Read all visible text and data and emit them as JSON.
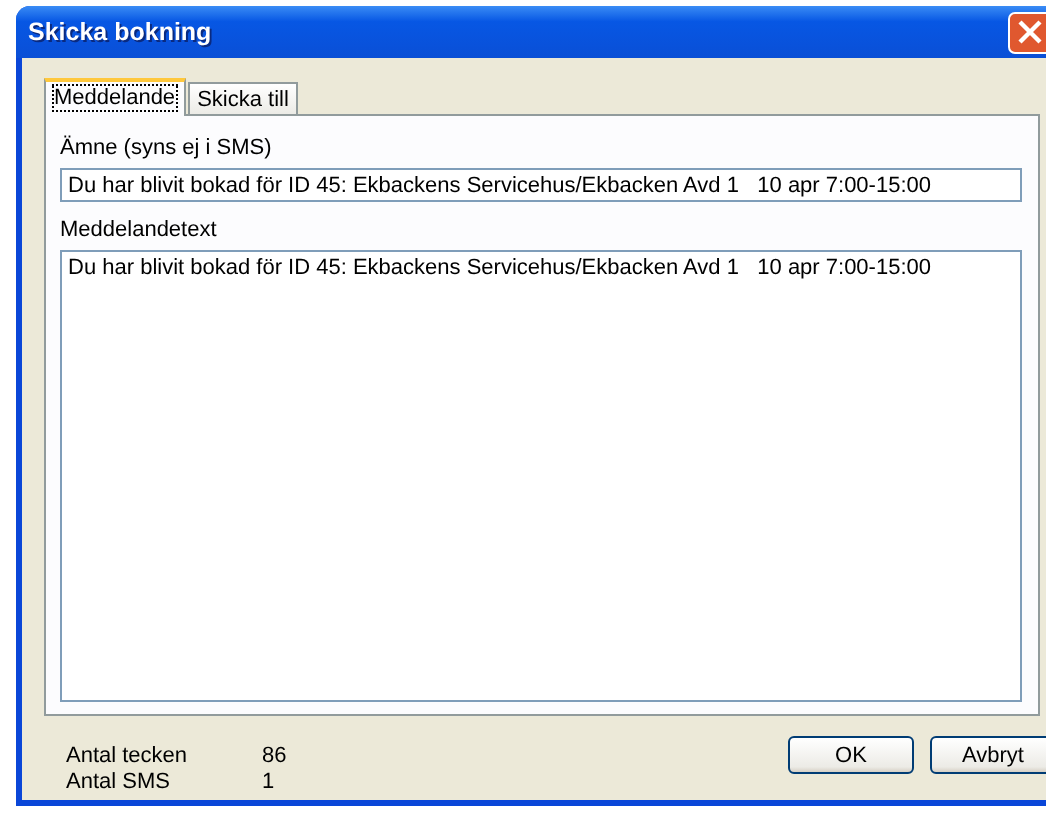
{
  "window": {
    "title": "Skicka bokning"
  },
  "tabs": [
    {
      "label": "Meddelande",
      "selected": true
    },
    {
      "label": "Skicka till",
      "selected": false
    }
  ],
  "subject": {
    "label": "Ämne (syns ej i SMS)",
    "value": "Du har blivit bokad för ID 45: Ekbackens Servicehus/Ekbacken Avd 1   10 apr 7:00-15:00"
  },
  "message": {
    "label": "Meddelandetext",
    "value": "Du har blivit bokad för ID 45: Ekbackens Servicehus/Ekbacken Avd 1   10 apr 7:00-15:00"
  },
  "stats": [
    {
      "label": "Antal tecken",
      "value": "86"
    },
    {
      "label": "Antal SMS",
      "value": "1"
    }
  ],
  "buttons": [
    "OK",
    "Avbryt"
  ]
}
